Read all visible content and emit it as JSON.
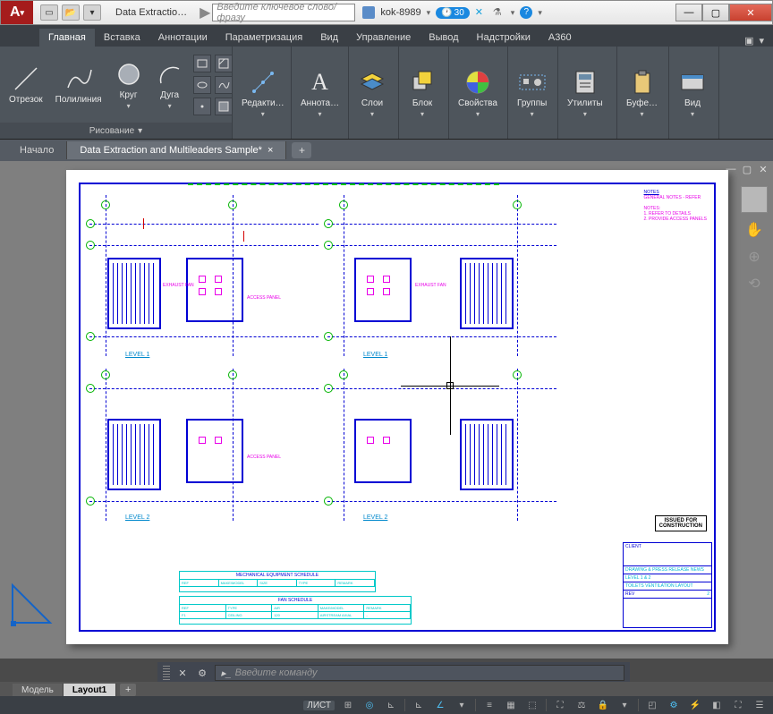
{
  "titlebar": {
    "app_initial": "A",
    "doc_title": "Data Extractio…",
    "search_placeholder": "Введите ключевое слово/фразу",
    "user": "kok-8989",
    "badge": "30"
  },
  "ribbon_tabs": [
    "Главная",
    "Вставка",
    "Аннотации",
    "Параметризация",
    "Вид",
    "Управление",
    "Вывод",
    "Надстройки",
    "A360"
  ],
  "ribbon": {
    "draw": {
      "title": "Рисование",
      "items": [
        "Отрезок",
        "Полилиния",
        "Круг",
        "Дуга"
      ]
    },
    "edit": "Редакти…",
    "anno": "Аннота…",
    "layers": "Слои",
    "block": "Блок",
    "props": "Свойства",
    "groups": "Группы",
    "utils": "Утилиты",
    "clip": "Буфе…",
    "view": "Вид"
  },
  "doc_tabs": {
    "start": "Начало",
    "active": "Data Extraction and Multileaders Sample*"
  },
  "drawing": {
    "levels": [
      "LEVEL 1",
      "LEVEL 1",
      "LEVEL 2",
      "LEVEL 2"
    ],
    "stamp": "ISSUED FOR\nCONSTRUCTION",
    "notes_hd": "NOTES",
    "notes_body": "GENERAL NOTES - REFER\n\nNOTES:\n1. REFER TO DETAILS\n2. PROVIDE ACCESS PANELS",
    "sched1_title": "MECHANICAL EQUIPMENT SCHEDULE",
    "sched1_cols": [
      "REF",
      "MAKE/MODEL",
      "SIZE",
      "TYPE",
      "REMARK"
    ],
    "sched2_title": "FAN SCHEDULE",
    "sched2_cols": [
      "REF",
      "TYPE",
      "AIR",
      "MAKE/MODEL",
      "REMARK"
    ],
    "title_block": {
      "client": "CLIENT",
      "project": "DRAWING & PRESS RELEASE NEWS",
      "dwg": "LEVEL 1 & 2",
      "sheet": "TOILETS VENTILATION LAYOUT",
      "rev": "2"
    }
  },
  "cmd": {
    "placeholder": "Введите команду"
  },
  "layout_tabs": {
    "model": "Модель",
    "layout": "Layout1"
  },
  "status": {
    "mode": "ЛИСТ"
  }
}
